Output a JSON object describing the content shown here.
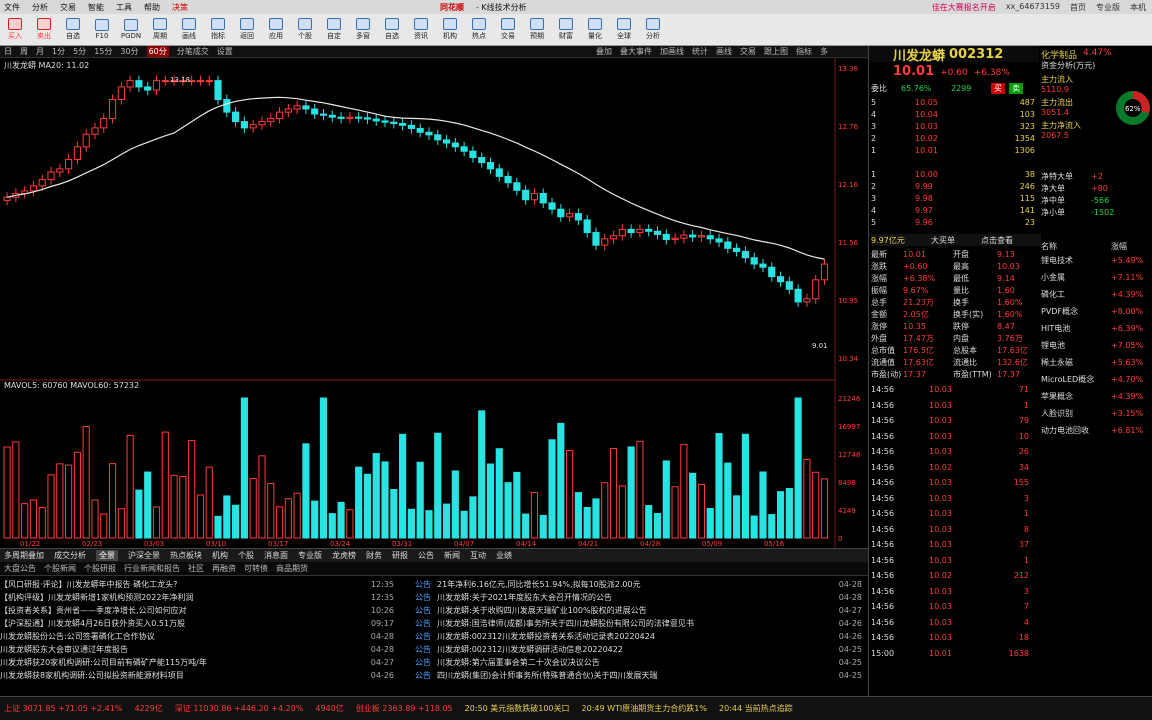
{
  "menu": {
    "items": [
      "文件",
      "分析",
      "交易",
      "智能",
      "工具",
      "帮助",
      "决策"
    ],
    "brand": "同花顺",
    "sub": "- K线技术分析",
    "right": [
      "佳在大赛报名开启",
      "xx_64673159",
      "首页",
      "专业版",
      "本机"
    ]
  },
  "toolbar": {
    "buttons": [
      "买入",
      "卖出",
      "自选",
      "F10",
      "PGDN",
      "周期",
      "画线",
      "指标",
      "返回",
      "应用",
      "个股",
      "自定",
      "多窗",
      "自选",
      "资讯",
      "机构",
      "热点",
      "交易",
      "预期",
      "财富",
      "量化",
      "全球",
      "分析"
    ]
  },
  "chart_tabs": {
    "items": [
      "日",
      "周",
      "月",
      "1分",
      "5分",
      "15分",
      "30分",
      "60分",
      "分笔成交",
      "设置"
    ],
    "selected": "60分",
    "right": [
      "叠加",
      "叠大事件",
      "加画线",
      "统计",
      "画线",
      "交易",
      "跟上图",
      "指标",
      "多"
    ]
  },
  "chart": {
    "header": "川发龙蟒 MA20: 11.02",
    "vol_header": "MAVOL5: 60760 MAVOL60: 57232"
  },
  "chart_data": [
    {
      "type": "candlestick",
      "title": "川发龙蟒 MA20: 11.02",
      "ylim": [
        8.8,
        13.4
      ],
      "yticks": [
        "13.36",
        "12.76",
        "12.16",
        "11.56",
        "10.95",
        "10.34"
      ],
      "annotations": [
        "13.18",
        "9.01"
      ],
      "ma20_label": "MA20: 11.02"
    },
    {
      "type": "bar",
      "title": "MAVOL5: 60760 MAVOL60: 57232",
      "ylim": [
        0,
        220000
      ],
      "yticks": [
        "21246",
        "16997",
        "12748",
        "8498",
        "4249",
        "0"
      ],
      "xlabels": [
        "01/22",
        "02/23",
        "03/03",
        "03/10",
        "03/17",
        "03/24",
        "03/31",
        "04/07",
        "04/14",
        "04/21",
        "04/28",
        "05/09",
        "05/16"
      ]
    }
  ],
  "quote": {
    "name": "川发龙蟒",
    "code": "002312",
    "price": "10.01",
    "change": "+0.60",
    "pct": "+6.38%",
    "sector": "化学制品",
    "sector_pct": "4.47%",
    "weibi": "65.76%",
    "weicha": "2299"
  },
  "orderbook": {
    "sells": [
      [
        "5",
        "10.05",
        "487"
      ],
      [
        "4",
        "10.04",
        "103"
      ],
      [
        "3",
        "10.03",
        "323"
      ],
      [
        "2",
        "10.02",
        "1354"
      ],
      [
        "1",
        "10.01",
        "1306"
      ]
    ],
    "buys": [
      [
        "1",
        "10.00",
        "38"
      ],
      [
        "2",
        "9.99",
        "246"
      ],
      [
        "3",
        "9.98",
        "115"
      ],
      [
        "4",
        "9.97",
        "141"
      ],
      [
        "5",
        "9.96",
        "23"
      ]
    ]
  },
  "fund": {
    "title": "资金分析(万元)",
    "items": [
      [
        "主力流入",
        "5110.9"
      ],
      [
        "主力流出",
        "3051.4"
      ],
      [
        "主力净流入",
        "2067.5"
      ]
    ],
    "donut": [
      "62%",
      "38%"
    ],
    "side": [
      [
        "净特大单",
        "+2"
      ],
      [
        "净大单",
        "+80"
      ],
      [
        "净中单",
        "-566"
      ],
      [
        "净小单",
        "-1502"
      ]
    ]
  },
  "stats": [
    [
      "最新",
      "10.01",
      "开盘",
      "9.13"
    ],
    [
      "涨跌",
      "+0.60",
      "最高",
      "10.03"
    ],
    [
      "涨幅",
      "+6.38%",
      "最低",
      "9.14"
    ],
    [
      "振幅",
      "9.67%",
      "量比",
      "1.60"
    ],
    [
      "总手",
      "21.23万",
      "换手",
      "1.60%"
    ],
    [
      "金额",
      "2.05亿",
      "换手(实)",
      "1.60%"
    ],
    [
      "涨停",
      "10.35",
      "跌停",
      "8.47"
    ],
    [
      "外盘",
      "17.47万",
      "内盘",
      "3.76万"
    ],
    [
      "总市值",
      "176.5亿",
      "总股本",
      "17.63亿"
    ],
    [
      "流通值",
      "17.63亿",
      "流通比",
      "132.6亿"
    ],
    [
      "市盈(动)",
      "17.37",
      "市盈(TTM)",
      "17.37"
    ]
  ],
  "ticks": [
    [
      "14:56",
      "10.03",
      "71"
    ],
    [
      "14:56",
      "10.03",
      "1"
    ],
    [
      "14:56",
      "10.03",
      "79"
    ],
    [
      "14:56",
      "10.03",
      "10"
    ],
    [
      "14:56",
      "10.03",
      "26"
    ],
    [
      "14:56",
      "10.02",
      "34"
    ],
    [
      "14:56",
      "10.03",
      "155"
    ],
    [
      "14:56",
      "10.03",
      "3"
    ],
    [
      "14:56",
      "10.03",
      "1"
    ],
    [
      "14:56",
      "10.03",
      "8"
    ],
    [
      "14:56",
      "10.03",
      "37"
    ],
    [
      "14:56",
      "10.03",
      "1"
    ],
    [
      "14:56",
      "10.02",
      "212"
    ],
    [
      "14:56",
      "10.03",
      "3"
    ],
    [
      "14:56",
      "10.03",
      "7"
    ],
    [
      "14:56",
      "10.03",
      "4"
    ],
    [
      "14:56",
      "10.03",
      "18"
    ],
    [
      "15:00",
      "10.01",
      "1638"
    ]
  ],
  "concepts": {
    "header": [
      "名称",
      "涨幅"
    ],
    "items": [
      [
        "锂电技术",
        "+5.49%"
      ],
      [
        "小金属",
        "+7.11%"
      ],
      [
        "磷化工",
        "+4.39%"
      ],
      [
        "PVDF概念",
        "+8.00%"
      ],
      [
        "HIT电池",
        "+6.39%"
      ],
      [
        "锂电池",
        "+7.05%"
      ],
      [
        "稀土永磁",
        "+5.63%"
      ],
      [
        "MicroLED概念",
        "+4.70%"
      ],
      [
        "苹果概念",
        "+4.39%"
      ],
      [
        "人脸识别",
        "+3.15%"
      ],
      [
        "动力电池回收",
        "+6.81%"
      ]
    ]
  },
  "news_tabs": {
    "items": [
      "多周期叠加",
      "成交分析",
      "全景",
      "沪深全景",
      "热点板块",
      "机构",
      "个股",
      "消息面",
      "专业版",
      "龙虎榜",
      "财务",
      "研报",
      "公告",
      "新闻",
      "互动",
      "业绩"
    ],
    "selected": "全景"
  },
  "news_sub": {
    "items": [
      "大盘公告",
      "个股新闻",
      "个股研报",
      "行业新闻和报告",
      "社区",
      "再融资",
      "可转债",
      "商品期货"
    ]
  },
  "news_left": [
    [
      "【风口研报·评论】川发龙蟒年中报告 磷化工龙头?",
      "12:35"
    ],
    [
      "【机构评级】川发龙蟒新增1家机构预测2022年净利润",
      "12:35"
    ],
    [
      "【投资者关系】贵州省——季度净增长,公司如何应对",
      "10:26"
    ],
    [
      "【沪深股通】川发龙蟒4月26日获外资买入0.51万股",
      "09:17"
    ],
    [
      "川发龙蟒股份公告:公司签署磷化工合作协议",
      "04-28"
    ],
    [
      "川发龙蟒股东大会审议通过年度报告",
      "04-28"
    ],
    [
      "川发龙蟒获20家机构调研:公司目前有磷矿产能115万吨/年",
      "04-27"
    ],
    [
      "川发龙蟒获8家机构调研:公司拟投资新能源材料项目",
      "04-26"
    ]
  ],
  "news_right": [
    [
      "公告",
      "21年净利6.16亿元,同比增长51.94%,拟每10股派2.00元",
      "04-28"
    ],
    [
      "公告",
      "川发龙蟒:关于2021年度股东大会召开情况的公告",
      "04-28"
    ],
    [
      "公告",
      "川发龙蟒:关于收购四川发展天瑞矿业100%股权的进展公告",
      "04-27"
    ],
    [
      "公告",
      "川发龙蟒:国浩律师(成都)事务所关于四川龙蟒股份有限公司的法律意见书",
      "04-26"
    ],
    [
      "公告",
      "川发龙蟒:002312川发龙蟒投资者关系活动记录表20220424",
      "04-26"
    ],
    [
      "公告",
      "川发龙蟒:002312川发龙蟒调研活动信息20220422",
      "04-25"
    ],
    [
      "公告",
      "川发龙蟒:第六届董事会第二十次会议决议公告",
      "04-25"
    ],
    [
      "公告",
      "四川龙蟒(集团)会计师事务所(特殊普通合伙)关于四川发展天瑞",
      "04-25"
    ]
  ],
  "status": [
    "上证 3071.85 +71.05 +2.41%",
    "4229亿",
    "深证 11030.86 +446.20 +4.20%",
    "4940亿",
    "创业板 2363.89 +118.05",
    "20:50 美元指数跌破100关口",
    "20:49 WTI原油期货主力合约跌1%",
    "20:44 当前热点追踪"
  ]
}
